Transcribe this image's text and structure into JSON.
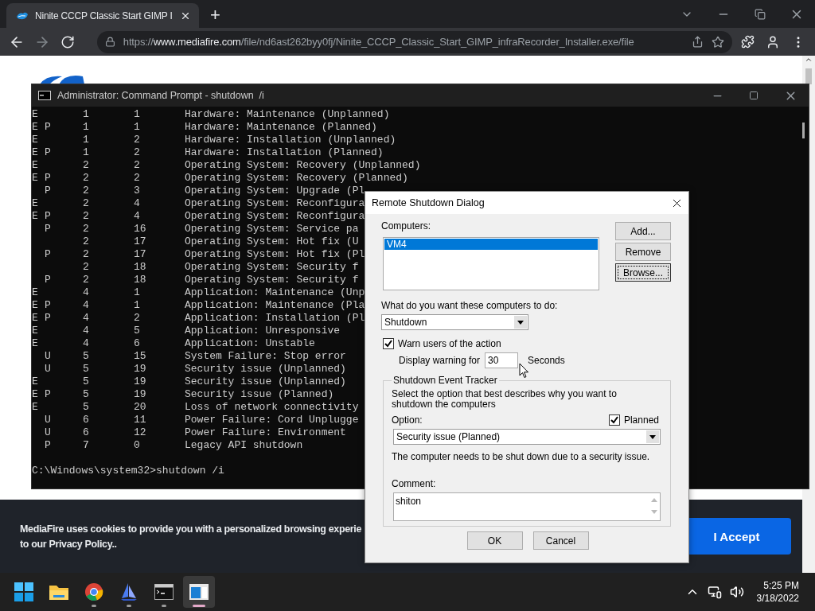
{
  "browser": {
    "tab": {
      "title": "Ninite CCCP Classic Start GIMP I",
      "selected": true
    },
    "new_tab": "+",
    "url": "https://**www.mediafire.com**/file/nd6ast262byy0fj/Ninite_CCCP_Classic_Start_GIMP_infraRecorder_Installer.exe/file"
  },
  "page": {
    "cookie_banner": {
      "lines": [
        "MediaFire uses cookies to provide you with a personalized browsing experie",
        "to our Privacy Policy.."
      ],
      "button": "I Accept"
    }
  },
  "cmd_window": {
    "title": "Administrator: Command Prompt - shutdown  /i",
    "rows": [
      {
        "flag": "E",
        "major": "1",
        "minor": "1",
        "reason": "Hardware: Maintenance (Unplanned)"
      },
      {
        "flag": "E",
        "type": "P",
        "major": "1",
        "minor": "1",
        "reason": "Hardware: Maintenance (Planned)"
      },
      {
        "flag": "E",
        "major": "1",
        "minor": "2",
        "reason": "Hardware: Installation (Unplanned)"
      },
      {
        "flag": "E",
        "type": "P",
        "major": "1",
        "minor": "2",
        "reason": "Hardware: Installation (Planned)"
      },
      {
        "flag": "E",
        "major": "2",
        "minor": "2",
        "reason": "Operating System: Recovery (Unplanned)"
      },
      {
        "flag": "E",
        "type": "P",
        "major": "2",
        "minor": "2",
        "reason": "Operating System: Recovery (Planned)"
      },
      {
        "type": "P",
        "major": "2",
        "minor": "3",
        "reason": "Operating System: Upgrade (Pl"
      },
      {
        "flag": "E",
        "major": "2",
        "minor": "4",
        "reason": "Operating System: Reconfigura"
      },
      {
        "flag": "E",
        "type": "P",
        "major": "2",
        "minor": "4",
        "reason": "Operating System: Reconfigura"
      },
      {
        "type": "P",
        "major": "2",
        "minor": "16",
        "reason": "Operating System: Service pa"
      },
      {
        "major": "2",
        "minor": "17",
        "reason": "Operating System: Hot fix (U"
      },
      {
        "type": "P",
        "major": "2",
        "minor": "17",
        "reason": "Operating System: Hot fix (Pl"
      },
      {
        "major": "2",
        "minor": "18",
        "reason": "Operating System: Security f"
      },
      {
        "type": "P",
        "major": "2",
        "minor": "18",
        "reason": "Operating System: Security f"
      },
      {
        "flag": "E",
        "major": "4",
        "minor": "1",
        "reason": "Application: Maintenance (Unp"
      },
      {
        "flag": "E",
        "type": "P",
        "major": "4",
        "minor": "1",
        "reason": "Application: Maintenance (Pla"
      },
      {
        "flag": "E",
        "type": "P",
        "major": "4",
        "minor": "2",
        "reason": "Application: Installation (Pl"
      },
      {
        "flag": "E",
        "major": "4",
        "minor": "5",
        "reason": "Application: Unresponsive"
      },
      {
        "flag": "E",
        "major": "4",
        "minor": "6",
        "reason": "Application: Unstable"
      },
      {
        "type": "U",
        "major": "5",
        "minor": "15",
        "reason": "System Failure: Stop error"
      },
      {
        "type": "U",
        "major": "5",
        "minor": "19",
        "reason": "Security issue (Unplanned)"
      },
      {
        "flag": "E",
        "major": "5",
        "minor": "19",
        "reason": "Security issue (Unplanned)"
      },
      {
        "flag": "E",
        "type": "P",
        "major": "5",
        "minor": "19",
        "reason": "Security issue (Planned)"
      },
      {
        "flag": "E",
        "major": "5",
        "minor": "20",
        "reason": "Loss of network connectivity"
      },
      {
        "type": "U",
        "major": "6",
        "minor": "11",
        "reason": "Power Failure: Cord Unplugge"
      },
      {
        "type": "U",
        "major": "6",
        "minor": "12",
        "reason": "Power Failure: Environment"
      },
      {
        "type": "P",
        "major": "7",
        "minor": "0",
        "reason": "Legacy API shutdown"
      }
    ],
    "prompt": "C:\\Windows\\system32>shutdown /i"
  },
  "dialog": {
    "title": "Remote Shutdown Dialog",
    "computers_label": "Computers:",
    "computers": [
      {
        "name": "VM4",
        "selected": true
      }
    ],
    "buttons": [
      {
        "label": "Add...",
        "focused": false
      },
      {
        "label": "Remove",
        "focused": false
      },
      {
        "label": "Browse...",
        "focused": true
      }
    ],
    "action_label": "What do you want these computers to do:",
    "action": "Shutdown",
    "warn": {
      "label": "Warn users of the action",
      "checked": true
    },
    "warning_label": "Display warning for",
    "warning_value": "30",
    "warning_unit": "Seconds",
    "tracker": {
      "legend": "Shutdown Event Tracker",
      "description": "Select the option that best describes why you want to shutdown the computers",
      "option_label": "Option:",
      "planned": {
        "label": "Planned",
        "checked": true
      },
      "option": "Security issue (Planned)",
      "option_description": "The computer needs to be shut down due to a security issue.",
      "comment_label": "Comment:",
      "comment": "shiton"
    },
    "footer_buttons": [
      "OK",
      "Cancel"
    ]
  },
  "taskbar": {
    "apps": [
      {
        "kind": "start",
        "running": false,
        "selected": false
      },
      {
        "kind": "explorer",
        "running": false,
        "selected": false
      },
      {
        "kind": "chrome",
        "running": true,
        "selected": false
      },
      {
        "kind": "sail",
        "running": true,
        "selected": false
      },
      {
        "kind": "terminal",
        "running": true,
        "selected": false
      },
      {
        "kind": "window",
        "running": true,
        "selected": true
      }
    ],
    "time": "5:25 PM",
    "date": "3/18/2022"
  }
}
